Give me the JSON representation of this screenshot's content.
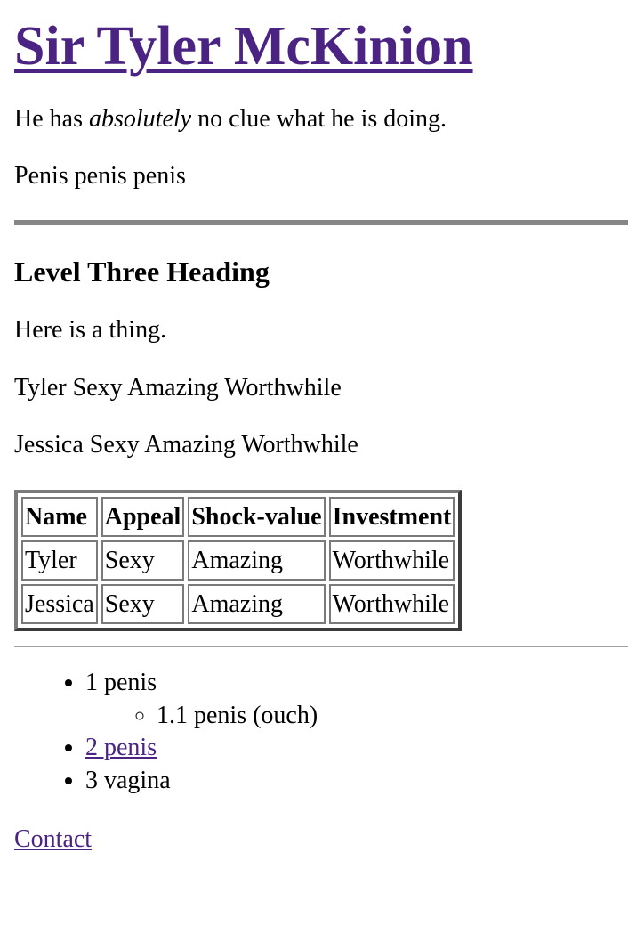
{
  "header": {
    "title": "Sir Tyler McKinion"
  },
  "intro": {
    "before": "He has ",
    "emphasis": "absolutely",
    "after": " no clue what he is doing."
  },
  "joke_line": "Penis penis penis",
  "section": {
    "heading": "Level Three Heading",
    "text": "Here is a thing.",
    "row_lines": [
      "Tyler Sexy Amazing Worthwhile",
      "Jessica Sexy Amazing Worthwhile"
    ]
  },
  "table": {
    "headers": [
      "Name",
      "Appeal",
      "Shock-value",
      "Investment"
    ],
    "rows": [
      [
        "Tyler",
        "Sexy",
        "Amazing",
        "Worthwhile"
      ],
      [
        "Jessica",
        "Sexy",
        "Amazing",
        "Worthwhile"
      ]
    ]
  },
  "list": {
    "item1": "1 penis",
    "item1_sub": "1.1 penis (ouch)",
    "item2": "2 penis",
    "item3": "3 vagina"
  },
  "footer": {
    "contact": "Contact"
  },
  "colors": {
    "link": "#4b2483",
    "rule": "#868686"
  }
}
